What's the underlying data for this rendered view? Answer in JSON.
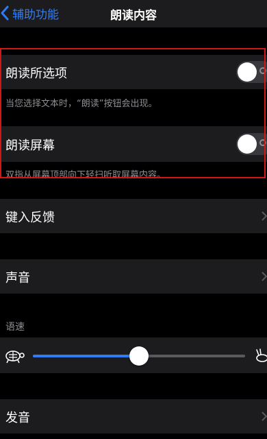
{
  "nav": {
    "back_label": "辅助功能",
    "title": "朗读内容"
  },
  "speak_selection": {
    "label": "朗读所选项",
    "enabled": false,
    "note": "当您选择文本时，“朗读”按钮会出现。"
  },
  "speak_screen": {
    "label": "朗读屏幕",
    "enabled": false,
    "note": "双指从屏幕顶部向下轻扫听取屏幕内容。"
  },
  "typing_feedback": {
    "label": "键入反馈"
  },
  "voices": {
    "label": "声音"
  },
  "speaking_rate": {
    "title": "语速",
    "value": 0.5
  },
  "pronunciations": {
    "label": "发音"
  },
  "colors": {
    "accent": "#2f7df6",
    "highlight_box": "#d01818",
    "cell_background": "#1c1c1e",
    "secondary_text": "#8e8e93"
  },
  "icons": {
    "back": "chevron-left-icon",
    "disclosure": "chevron-right-icon",
    "slow": "turtle-icon",
    "fast": "rabbit-icon"
  }
}
